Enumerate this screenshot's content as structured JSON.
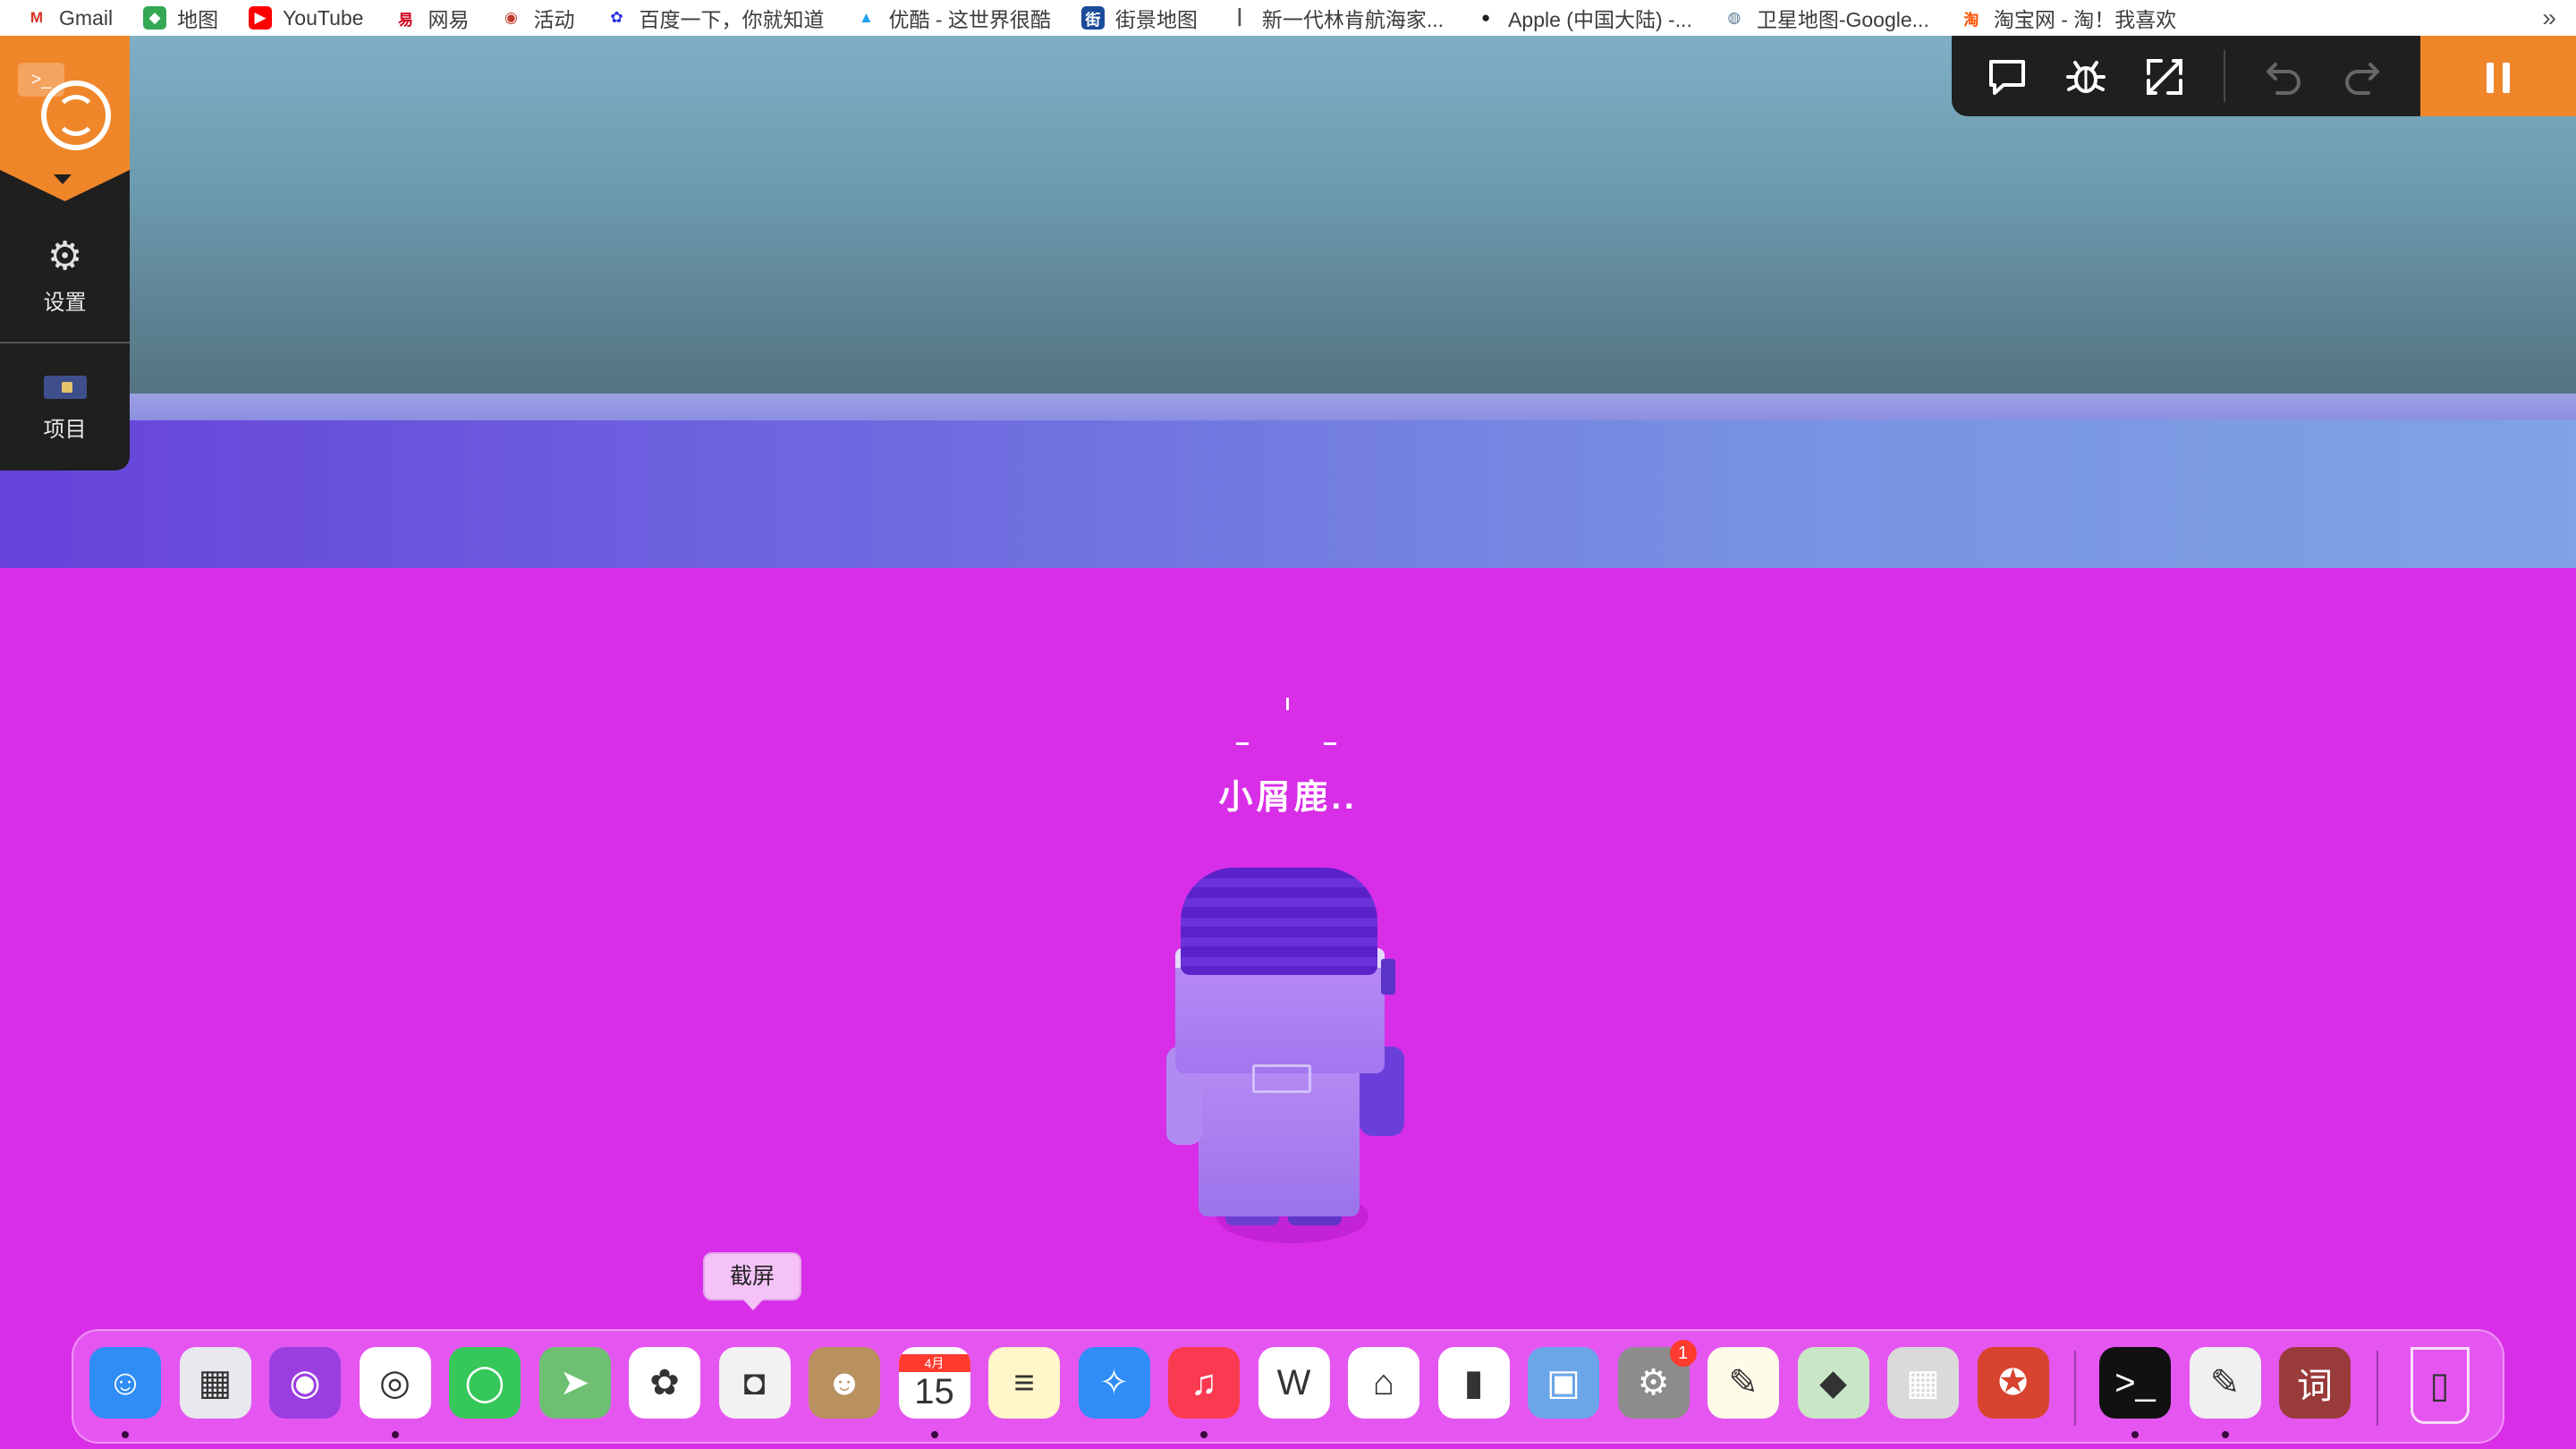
{
  "bookmarks": [
    {
      "label": "Gmail",
      "icon": "gmail-icon",
      "color": "#ffffff",
      "glyph": "M",
      "glyph_color": "#d93025"
    },
    {
      "label": "地图",
      "icon": "maps-icon",
      "color": "#34a853",
      "glyph": "◆",
      "glyph_color": "#ffffff"
    },
    {
      "label": "YouTube",
      "icon": "youtube-icon",
      "color": "#ff0000",
      "glyph": "▶",
      "glyph_color": "#ffffff"
    },
    {
      "label": "网易",
      "icon": "netease-icon",
      "color": "#ffffff",
      "glyph": "易",
      "glyph_color": "#d0021b"
    },
    {
      "label": "活动",
      "icon": "activity-icon",
      "color": "#ffffff",
      "glyph": "◉",
      "glyph_color": "#c0392b"
    },
    {
      "label": "百度一下，你就知道",
      "icon": "baidu-icon",
      "color": "#ffffff",
      "glyph": "✿",
      "glyph_color": "#2932e1"
    },
    {
      "label": "优酷 - 这世界很酷",
      "icon": "youku-icon",
      "color": "#ffffff",
      "glyph": "▲",
      "glyph_color": "#1da1f2"
    },
    {
      "label": "街景地图",
      "icon": "streetview-icon",
      "color": "#1a4b9b",
      "glyph": "街",
      "glyph_color": "#ffffff"
    },
    {
      "label": "新一代林肯航海家...",
      "icon": "lincoln-icon",
      "color": "#ffffff",
      "glyph": "┃",
      "glyph_color": "#555555"
    },
    {
      "label": "Apple (中国大陆) -...",
      "icon": "apple-icon",
      "color": "#ffffff",
      "glyph": "●",
      "glyph_color": "#222222"
    },
    {
      "label": "卫星地图-Google...",
      "icon": "globe-icon",
      "color": "#ffffff",
      "glyph": "◍",
      "glyph_color": "#5d7f9a"
    },
    {
      "label": "淘宝网 - 淘！我喜欢",
      "icon": "taobao-icon",
      "color": "#ffffff",
      "glyph": "淘",
      "glyph_color": "#ff5000"
    }
  ],
  "bookmarks_more": "»",
  "side_panel": {
    "terminal_glyph": ">_",
    "settings_label": "设置",
    "settings_glyph": "⚙",
    "project_label": "项目"
  },
  "toolbar": {
    "comment_icon": "comment-icon",
    "debug_icon": "bug-icon",
    "fullscreen_icon": "expand-icon",
    "undo_icon": "undo-icon",
    "redo_icon": "redo-icon",
    "pause_icon": "pause-icon"
  },
  "scene": {
    "npc_name": "小屑鹿.."
  },
  "tooltip": {
    "text": "截屏"
  },
  "dock": {
    "apps": [
      {
        "name": "finder",
        "bg": "#2f8df5",
        "glyph": "☺",
        "running": true
      },
      {
        "name": "launchpad",
        "bg": "#e8e8ee",
        "glyph": "▦",
        "running": false
      },
      {
        "name": "podcasts",
        "bg": "#9b3ee0",
        "glyph": "◉",
        "running": false
      },
      {
        "name": "chrome",
        "bg": "#ffffff",
        "glyph": "◎",
        "running": true
      },
      {
        "name": "messages",
        "bg": "#35c759",
        "glyph": "◯",
        "running": false
      },
      {
        "name": "maps",
        "bg": "#6fbf73",
        "glyph": "➤",
        "running": false
      },
      {
        "name": "photos",
        "bg": "#ffffff",
        "glyph": "✿",
        "running": false
      },
      {
        "name": "screenshot",
        "bg": "#f2f2f2",
        "glyph": "◘",
        "running": false
      },
      {
        "name": "contacts",
        "bg": "#b9915f",
        "glyph": "☻",
        "running": false
      },
      {
        "name": "calendar",
        "bg": "#ffffff",
        "glyph": "15",
        "running": true,
        "month": "4月"
      },
      {
        "name": "notes",
        "bg": "#fff6c9",
        "glyph": "≡",
        "running": false
      },
      {
        "name": "safari",
        "bg": "#2f8df5",
        "glyph": "✧",
        "running": false
      },
      {
        "name": "music",
        "bg": "#fa3a51",
        "glyph": "♫",
        "running": true
      },
      {
        "name": "wps",
        "bg": "#ffffff",
        "glyph": "W",
        "running": false
      },
      {
        "name": "keynote",
        "bg": "#ffffff",
        "glyph": "⌂",
        "running": false
      },
      {
        "name": "numbers",
        "bg": "#ffffff",
        "glyph": "▮",
        "running": false
      },
      {
        "name": "screen-sharing",
        "bg": "#6ba6e8",
        "glyph": "▣",
        "running": false
      },
      {
        "name": "system-preferences",
        "bg": "#8c8c8c",
        "glyph": "⚙",
        "running": false,
        "badge": "1"
      },
      {
        "name": "pages",
        "bg": "#fffbe9",
        "glyph": "✎",
        "running": false
      },
      {
        "name": "pixelmator",
        "bg": "#c9e6c6",
        "glyph": "◆",
        "running": false
      },
      {
        "name": "calculator",
        "bg": "#dadada",
        "glyph": "▦",
        "running": false
      },
      {
        "name": "digital-color-meter",
        "bg": "#d8432f",
        "glyph": "✪",
        "running": false
      },
      {
        "name": "terminal",
        "bg": "#111111",
        "glyph": ">_",
        "running": true
      },
      {
        "name": "script-editor",
        "bg": "#f0f0f0",
        "glyph": "✎",
        "running": true
      },
      {
        "name": "dictionary",
        "bg": "#9a3b3b",
        "glyph": "词",
        "running": false
      },
      {
        "name": "trash",
        "bg": "transparent",
        "glyph": "▯",
        "running": false
      }
    ]
  }
}
